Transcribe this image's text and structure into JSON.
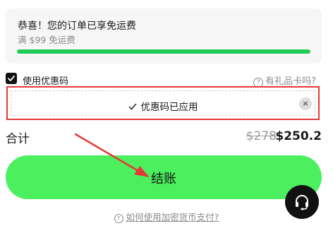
{
  "shipping": {
    "title": "恭喜！您的订单已享免运费",
    "subtitle": "满 $99 免运费",
    "progress": 1.0
  },
  "coupon": {
    "checkbox_label": "使用优惠码",
    "gift_link": "有礼品卡吗?",
    "applied_text": "优惠码已应用",
    "remove_symbol": "×"
  },
  "summary": {
    "total_label": "合计",
    "original_price": "$278",
    "final_price": "$250.2"
  },
  "checkout": {
    "button_label": "结账"
  },
  "crypto": {
    "link_text": "如何使用加密货币支付?"
  },
  "colors": {
    "accent_green": "#4cf05f",
    "progress_green": "#1fcb54",
    "highlight_red": "#e53935"
  },
  "icons": {
    "checkbox": "checkmark-icon",
    "applied": "check-icon",
    "remove": "close-icon",
    "help": "question-circle-icon",
    "support": "headset-icon"
  }
}
